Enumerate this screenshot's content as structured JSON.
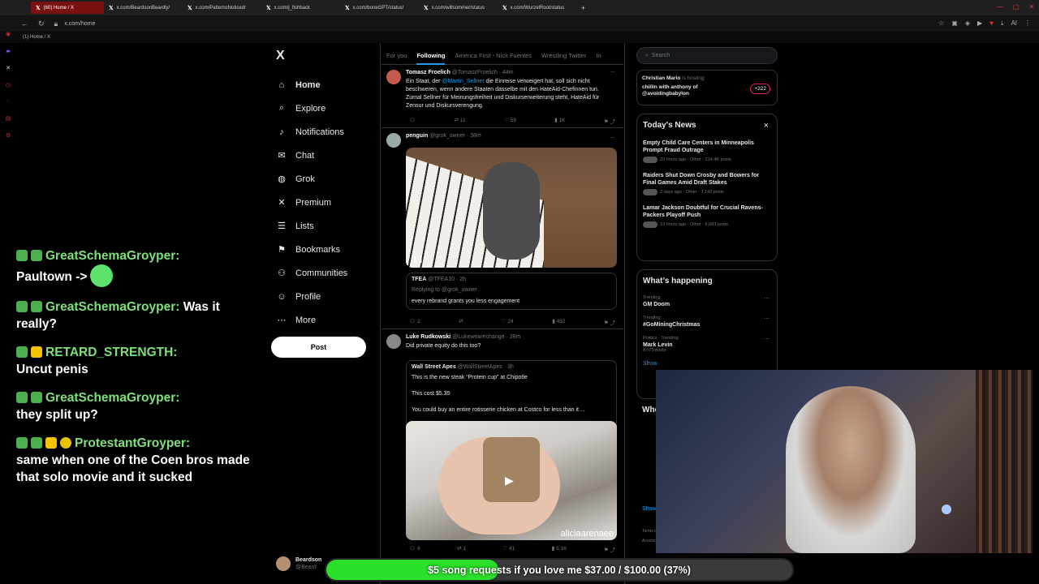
{
  "browser": {
    "tabs": [
      {
        "label": "(60) Home / X",
        "active": true
      },
      {
        "label": "x.com/BeardsonBeardly/",
        "active": false
      },
      {
        "label": "x.com/PatternsNoticed/",
        "active": false
      },
      {
        "label": "x.com/j_fishback",
        "active": false
      },
      {
        "label": "x.com/boneGPT/status/",
        "active": false
      },
      {
        "label": "x.com/willsommer/status",
        "active": false
      },
      {
        "label": "x.com/WurzelRoot/status",
        "active": false
      }
    ],
    "new_tab": "+",
    "url": "x.com/home",
    "bookmark": "(1) Home / X",
    "ai_label": "AI"
  },
  "chat": {
    "messages": [
      {
        "user": "GreatSchemaGroyper:",
        "text": "Paultown ->"
      },
      {
        "user": "GreatSchemaGroyper:",
        "text": "Was it really?"
      },
      {
        "user": "RETARD_STRENGTH:",
        "text": "Uncut penis"
      },
      {
        "user": "GreatSchemaGroyper:",
        "text": "they split up?"
      },
      {
        "user": "ProtestantGroyper:",
        "text": "same when one of the Coen bros made that solo movie and it sucked"
      }
    ]
  },
  "x": {
    "logo": "X",
    "nav": [
      {
        "label": "Home",
        "icon": "home-icon",
        "glyph": "⌂"
      },
      {
        "label": "Explore",
        "icon": "search-icon",
        "glyph": "⌕"
      },
      {
        "label": "Notifications",
        "icon": "bell-icon",
        "glyph": "♪"
      },
      {
        "label": "Chat",
        "icon": "chat-icon",
        "glyph": "✉"
      },
      {
        "label": "Grok",
        "icon": "grok-icon",
        "glyph": "◍"
      },
      {
        "label": "Premium",
        "icon": "x-icon",
        "glyph": "✕"
      },
      {
        "label": "Lists",
        "icon": "list-icon",
        "glyph": "☰"
      },
      {
        "label": "Bookmarks",
        "icon": "bookmark-icon",
        "glyph": "⚑"
      },
      {
        "label": "Communities",
        "icon": "people-icon",
        "glyph": "⚇"
      },
      {
        "label": "Profile",
        "icon": "person-icon",
        "glyph": "☺"
      },
      {
        "label": "More",
        "icon": "more-icon",
        "glyph": "⋯"
      }
    ],
    "post_button": "Post",
    "account": {
      "name": "Beardson",
      "handle": "@Beard"
    },
    "timeline_tabs": [
      "For you",
      "Following",
      "America First - Nick Fuentes",
      "Wrestling Twitter",
      "In"
    ],
    "active_tab": "Following",
    "tweets": [
      {
        "name": "Tomasz Froelich",
        "handle": "@TomaszFroelich · 44m",
        "text_pre": "Ein Staat, der ",
        "mention": "@Martin_Sellner",
        "text_post": " die Einreise verweigert hat, soll sich nicht beschweren, wenn andere Staaten dasselbe mit den HateAid-Chefinnen tun. Zumal Sellner für Meinungsfreiheit und Diskurserweiterung steht, HateAid für Zensur und Diskursverengung.",
        "replies": "",
        "reposts": "11",
        "likes": "59",
        "views": "1K"
      },
      {
        "name": "penguin",
        "handle": "@grok_owner · 38m",
        "quote_name": "TFEA",
        "quote_handle": "@TFEA10 · 2h",
        "quote_reply": "Replying to @grok_owner",
        "quote_text": "every rebrand grants you less engagement",
        "replies": "2",
        "reposts": "",
        "likes": "24",
        "views": "452"
      },
      {
        "name": "Luke Rudkowski",
        "handle": "@Lukewearechange · 38m",
        "text": "Did private equity do this too?",
        "quote_name": "Wall Street Apes",
        "quote_handle": "@WallStreetApes · 3h",
        "quote_line1": "This is the new steak “Protein cup” at Chipotle",
        "quote_line2": "This cost $5.35",
        "quote_line3": "You could buy an entire rotisserie chicken at Costco for less than it ...",
        "watermark": "aliciaarenaee",
        "replies": "6",
        "reposts": "1",
        "likes": "41",
        "views": "5.1K"
      }
    ],
    "search_placeholder": "Search",
    "spaces": {
      "host": "Christian Mario",
      "status": "is hosting",
      "title": "chillin with anthony of @avoidingbabylon",
      "listeners": "+222"
    },
    "todays_news": {
      "title": "Today's News",
      "close": "×",
      "items": [
        {
          "headline": "Empty Child Care Centers in Minneapolis Prompt Fraud Outrage",
          "meta": "23 hours ago · Other · 214.4K posts"
        },
        {
          "headline": "Raiders Shut Down Crosby and Bowers for Final Games Amid Draft Stakes",
          "meta": "2 days ago · Other · 7,143 posts"
        },
        {
          "headline": "Lamar Jackson Doubtful for Crucial Ravens-Packers Playoff Push",
          "meta": "13 hours ago · Other · 6,083 posts"
        }
      ]
    },
    "happening": {
      "title": "What’s happening",
      "trends": [
        {
          "context": "Trending",
          "name": "GM Doom",
          "posts": ""
        },
        {
          "context": "Trending",
          "name": "#GoMiningChristmas",
          "posts": ""
        },
        {
          "context": "Politics · Trending",
          "name": "Mark Levin",
          "posts": "8,075 posts"
        }
      ],
      "show_more": "Show",
      "who": "Who",
      "show_more2": "Show",
      "terms": "Terms o",
      "access": "Access"
    }
  },
  "donation": {
    "text": "$5 song requests if you love me $37.00 / $100.00 (37%)",
    "progress": 0.37,
    "color": "#2be02b"
  }
}
